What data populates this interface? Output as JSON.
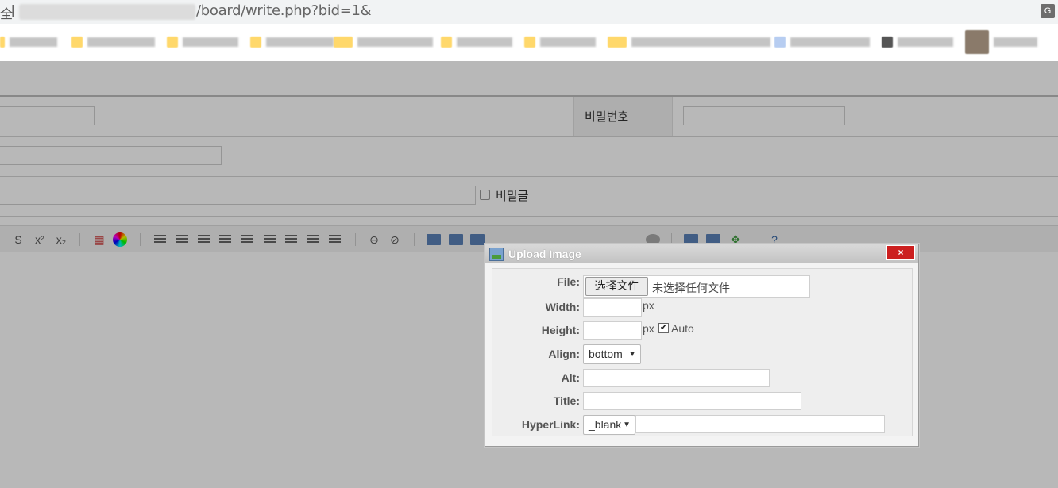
{
  "browser": {
    "url_path": "/board/write.php?bid=1&",
    "lock_glyph": "全",
    "separator": "|",
    "translate_icon": "G"
  },
  "form": {
    "password_label": "비밀번호",
    "secret_label": "비밀글"
  },
  "dialog": {
    "title": "Upload Image",
    "close_label": "×",
    "file_label": "File:",
    "file_button": "选择文件",
    "file_status": "未选择任何文件",
    "width_label": "Width:",
    "width_unit": "px",
    "height_label": "Height:",
    "height_unit": "px",
    "auto_label": "Auto",
    "auto_checked": true,
    "align_label": "Align:",
    "align_value": "bottom",
    "alt_label": "Alt:",
    "title_label": "Title:",
    "hyperlink_label": "HyperLink:",
    "hyperlink_target": "_blank",
    "width_value": "",
    "height_value": "",
    "alt_value": "",
    "title_value": "",
    "hyperlink_value": ""
  },
  "toolbar": {
    "strike": "S",
    "superscript": "x²",
    "subscript": "x₂"
  },
  "colors": {
    "close_button": "#cc1f1f",
    "title_bar": "#c8c8c8",
    "overlay": "rgba(0,0,0,0.28)"
  }
}
